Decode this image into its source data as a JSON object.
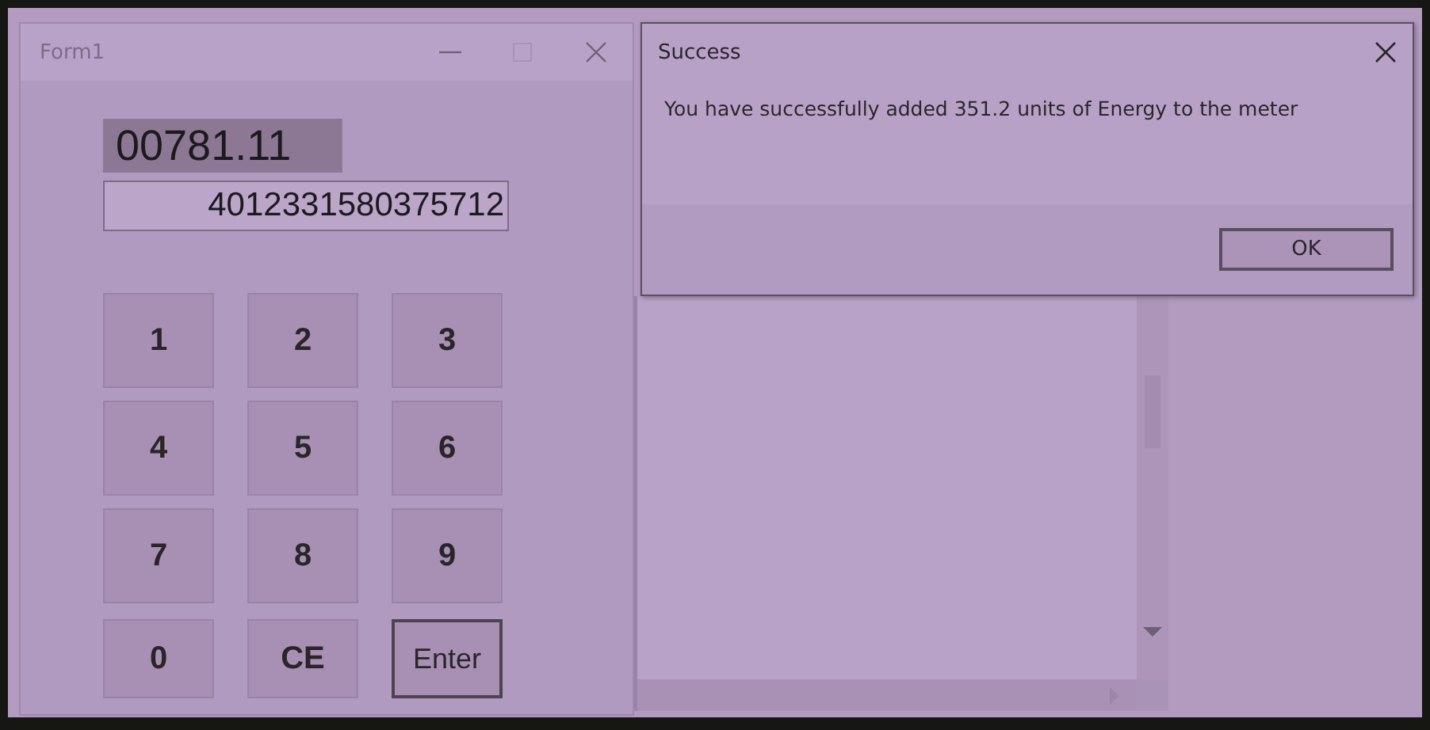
{
  "form_window": {
    "title": "Form1",
    "reading": "00781.11",
    "meter_number": "4012331580375712",
    "keys": [
      {
        "label": "1",
        "focused": false
      },
      {
        "label": "2",
        "focused": false
      },
      {
        "label": "3",
        "focused": false
      },
      {
        "label": "4",
        "focused": false
      },
      {
        "label": "5",
        "focused": false
      },
      {
        "label": "6",
        "focused": false
      },
      {
        "label": "7",
        "focused": false
      },
      {
        "label": "8",
        "focused": false
      },
      {
        "label": "9",
        "focused": false
      },
      {
        "label": "0",
        "focused": false
      },
      {
        "label": "CE",
        "focused": false
      },
      {
        "label": "Enter",
        "focused": true
      }
    ]
  },
  "dialog": {
    "title": "Success",
    "message": "You have successfully added 351.2 units of Energy to the meter",
    "buttons": [
      "OK"
    ]
  }
}
